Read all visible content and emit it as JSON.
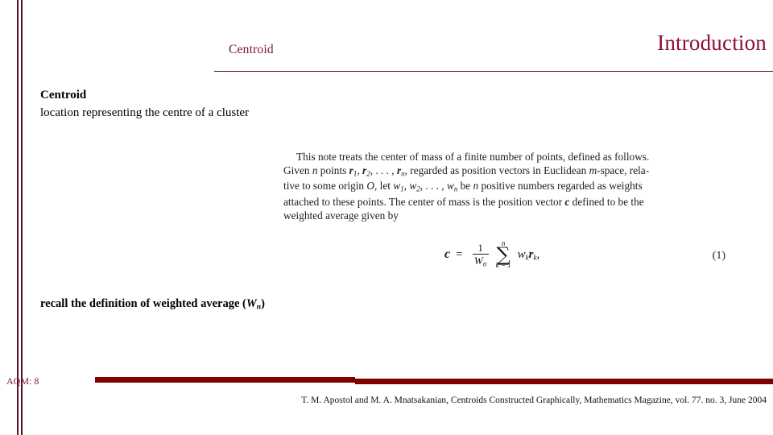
{
  "slide": {
    "title": "Introduction",
    "subtitle": "Centroid",
    "page_label": "AQM: 8",
    "accent_color": "#8a1133",
    "rule_color": "#4a1026",
    "bar_color": "#800000",
    "stripe_color": "#5a1020"
  },
  "body": {
    "term": "Centroid",
    "definition": "location representing the centre of a cluster"
  },
  "excerpt": {
    "line1": "This note treats the center of mass of a finite number of points, defined as follows.",
    "line2_a": "Given ",
    "line2_n": "n",
    "line2_b": " points ",
    "line2_r1": "r",
    "line2_r1sub": "1",
    "line2_r2": "r",
    "line2_r2sub": "2",
    "line2_dots": ", . . . , ",
    "line2_rn": "r",
    "line2_rnsub": "n",
    "line2_c": ", regarded as position vectors in Euclidean ",
    "line2_m": "m",
    "line2_d": "-space, rela-",
    "line3_a": "tive to some origin ",
    "line3_O": "O",
    "line3_b": ", let ",
    "line3_w1": "w",
    "line3_w1sub": "1",
    "line3_w2": "w",
    "line3_w2sub": "2",
    "line3_dots": ", . . . , ",
    "line3_wn": "w",
    "line3_wnsub": "n",
    "line3_c": " be ",
    "line3_n": "n",
    "line3_d": " positive numbers regarded as weights",
    "line4_a": "attached to these points. The center of mass is the position vector ",
    "line4_c": "c",
    "line4_b": " defined to be the",
    "line5": "weighted average given by"
  },
  "equation": {
    "lhs": "c",
    "equals": "=",
    "frac_num": "1",
    "frac_den": "W",
    "frac_den_sub": "n",
    "sigma_top": "n",
    "sigma_glyph": "∑",
    "sigma_bottom": "k = 1",
    "term_w": "w",
    "term_w_sub": "k",
    "term_r": "r",
    "term_r_sub": "k",
    "term_comma": ",",
    "number": "(1)"
  },
  "recall": {
    "text_before": "recall the definition of weighted average (",
    "symbol": "W",
    "symbol_sub": "n",
    "text_after": ")"
  },
  "citation": {
    "line1": "T. M. Apostol and M. A. Mnatsakanian, Centroids Constructed Graphically, Mathematics Magazine, vol.",
    "line2": "77. no. 3, June 2004"
  }
}
